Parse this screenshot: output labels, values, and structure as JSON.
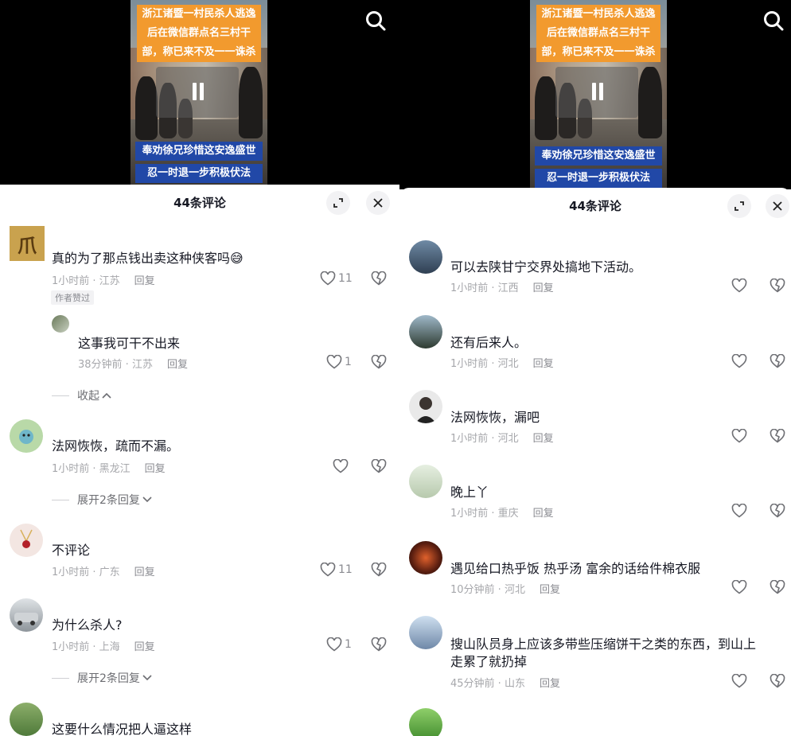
{
  "header": {
    "comment_count_title": "44条评论"
  },
  "video": {
    "caption_top": [
      "浙江诸暨一村民杀人逃逸",
      "后在微信群点名三村干",
      "部，称已来不及一一诛杀"
    ],
    "caption_bottom": [
      "奉劝徐兄珍惜这安逸盛世",
      "忍一时退一步积极伏法"
    ]
  },
  "left": {
    "comments": [
      {
        "text": "真的为了那点钱出卖这种侠客吗",
        "emoji": "😅",
        "time": "1小时前 · 江苏",
        "reply": "回复",
        "likes": "11",
        "tag": "作者赞过",
        "avatar_text": "爪"
      },
      {
        "text": "这事我可干不出来",
        "time": "38分钟前 · 江苏",
        "reply": "回复",
        "likes": "1"
      },
      {
        "text": "法网恢恢，疏而不漏。",
        "time": "1小时前 · 黑龙江",
        "reply": "回复",
        "likes": ""
      },
      {
        "text": "不评论",
        "time": "1小时前 · 广东",
        "reply": "回复",
        "likes": "11"
      },
      {
        "text": "为什么杀人?",
        "time": "1小时前 · 上海",
        "reply": "回复",
        "likes": "1"
      },
      {
        "text": "这要什么情况把人逼这样"
      }
    ],
    "fold_label": "收起",
    "expand_label_1": "展开2条回复",
    "expand_label_2": "展开2条回复"
  },
  "right": {
    "comments": [
      {
        "text": "可以去陕甘宁交界处搞地下活动。",
        "time": "1小时前 · 江西",
        "reply": "回复"
      },
      {
        "text": "还有后来人。",
        "time": "1小时前 · 河北",
        "reply": "回复"
      },
      {
        "text": "法网恢恢，漏吧",
        "time": "1小时前 · 河北",
        "reply": "回复"
      },
      {
        "text": "晚上丫",
        "time": "1小时前 · 重庆",
        "reply": "回复"
      },
      {
        "text": "遇见给口热乎饭 热乎汤 富余的话给件棉衣服",
        "time": "10分钟前 · 河北",
        "reply": "回复"
      },
      {
        "text_line1": "搜山队员身上应该多带些压缩饼干之类的东西，到山上",
        "text_line2": "走累了就扔掉",
        "time": "45分钟前 · 山东",
        "reply": "回复"
      }
    ]
  },
  "colors": {
    "caption_orange": "#f29a2e",
    "caption_blue": "#2148a7",
    "meta_gray": "#a6a7ab"
  }
}
